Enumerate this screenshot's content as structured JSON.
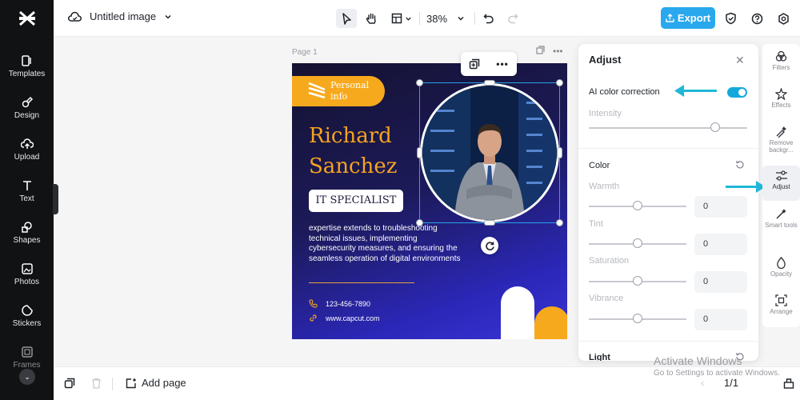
{
  "app": {
    "document_title": "Untitled image",
    "page_label": "Page 1"
  },
  "left_rail": [
    {
      "label": "Templates",
      "icon": "templates-icon"
    },
    {
      "label": "Design",
      "icon": "design-icon"
    },
    {
      "label": "Upload",
      "icon": "upload-icon"
    },
    {
      "label": "Text",
      "icon": "text-icon"
    },
    {
      "label": "Shapes",
      "icon": "shapes-icon"
    },
    {
      "label": "Photos",
      "icon": "photos-icon"
    },
    {
      "label": "Stickers",
      "icon": "stickers-icon"
    },
    {
      "label": "Frames",
      "icon": "frames-icon"
    }
  ],
  "toolbar": {
    "zoom": "38%",
    "export_label": "Export"
  },
  "bottom": {
    "add_page_label": "Add page",
    "page_count": "1/1"
  },
  "design": {
    "badge": "Personal info",
    "name_line1": "Richard",
    "name_line2": "Sanchez",
    "role": "IT SPECIALIST",
    "blurb": "expertise extends to troubleshooting technical issues, implementing cybersecurity measures, and ensuring the seamless operation of digital environments",
    "phone": "123-456-7890",
    "website": "www.capcut.com",
    "accent": "#f7a91d",
    "background": "#1c1a58"
  },
  "adjust_panel": {
    "title": "Adjust",
    "ai_color_correction": {
      "label": "AI color correction",
      "enabled": true
    },
    "intensity": {
      "label": "Intensity",
      "value_fraction": 0.8
    },
    "color_section": "Color",
    "sliders": [
      {
        "label": "Warmth",
        "value": "0"
      },
      {
        "label": "Tint",
        "value": "0"
      },
      {
        "label": "Saturation",
        "value": "0"
      },
      {
        "label": "Vibrance",
        "value": "0"
      }
    ],
    "light_section": "Light"
  },
  "right_rail": [
    {
      "label": "Filters",
      "icon": "filters-icon"
    },
    {
      "label": "Effects",
      "icon": "effects-icon"
    },
    {
      "label": "Remove backgr...",
      "icon": "remove-background-icon"
    },
    {
      "label": "Adjust",
      "icon": "adjust-icon",
      "active": true
    },
    {
      "label": "Smart tools",
      "icon": "smart-tools-icon"
    },
    {
      "label": "Opacity",
      "icon": "opacity-icon"
    },
    {
      "label": "Arrange",
      "icon": "arrange-icon"
    }
  ],
  "watermark": {
    "line1": "Activate Windows",
    "line2": "Go to Settings to activate Windows."
  },
  "colors": {
    "export": "#29a8ee",
    "highlight_arrow": "#20b7d8",
    "toggle_on": "#14a9d9"
  }
}
